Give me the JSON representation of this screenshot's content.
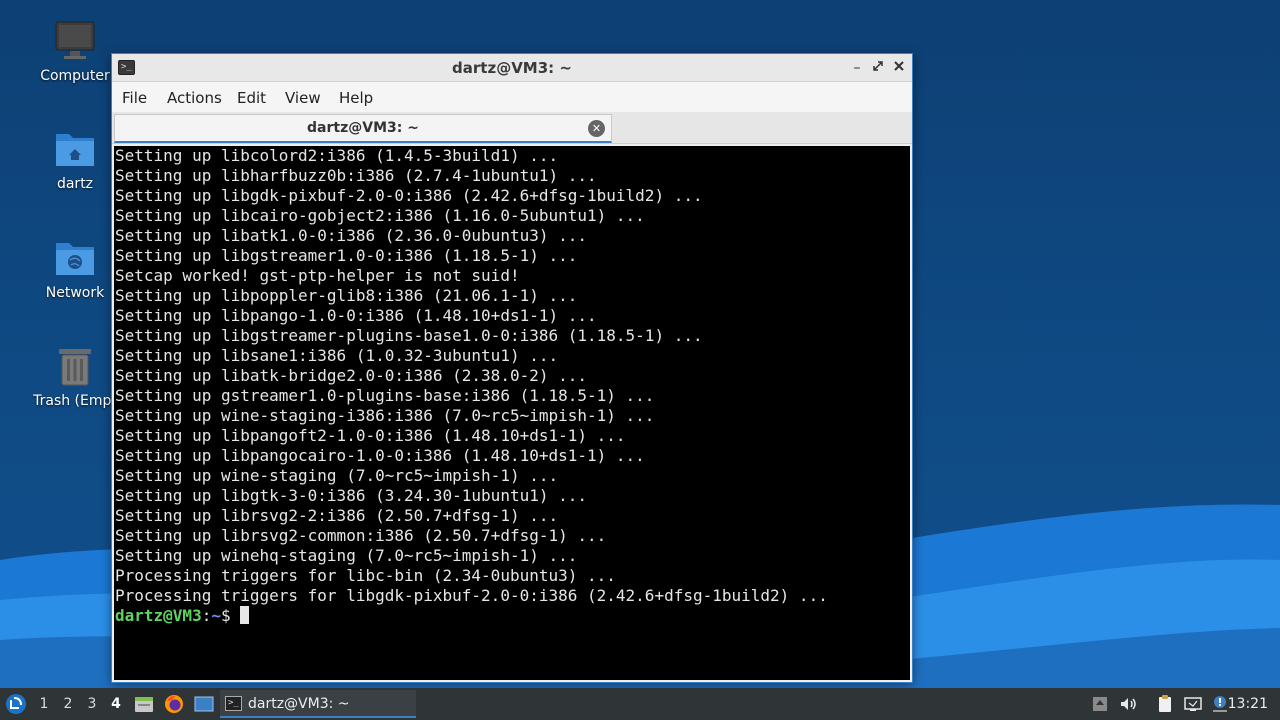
{
  "desktop": {
    "icons": [
      {
        "label": "Computer"
      },
      {
        "label": "dartz"
      },
      {
        "label": "Network"
      },
      {
        "label": "Trash (Empt"
      }
    ]
  },
  "window": {
    "title": "dartz@VM3: ~",
    "menu": [
      "File",
      "Actions",
      "Edit",
      "View",
      "Help"
    ],
    "tab_title": "dartz@VM3: ~",
    "terminal_lines": [
      "Setting up libcolord2:i386 (1.4.5-3build1) ...",
      "Setting up libharfbuzz0b:i386 (2.7.4-1ubuntu1) ...",
      "Setting up libgdk-pixbuf-2.0-0:i386 (2.42.6+dfsg-1build2) ...",
      "Setting up libcairo-gobject2:i386 (1.16.0-5ubuntu1) ...",
      "Setting up libatk1.0-0:i386 (2.36.0-0ubuntu3) ...",
      "Setting up libgstreamer1.0-0:i386 (1.18.5-1) ...",
      "Setcap worked! gst-ptp-helper is not suid!",
      "Setting up libpoppler-glib8:i386 (21.06.1-1) ...",
      "Setting up libpango-1.0-0:i386 (1.48.10+ds1-1) ...",
      "Setting up libgstreamer-plugins-base1.0-0:i386 (1.18.5-1) ...",
      "Setting up libsane1:i386 (1.0.32-3ubuntu1) ...",
      "Setting up libatk-bridge2.0-0:i386 (2.38.0-2) ...",
      "Setting up gstreamer1.0-plugins-base:i386 (1.18.5-1) ...",
      "Setting up wine-staging-i386:i386 (7.0~rc5~impish-1) ...",
      "Setting up libpangoft2-1.0-0:i386 (1.48.10+ds1-1) ...",
      "Setting up libpangocairo-1.0-0:i386 (1.48.10+ds1-1) ...",
      "Setting up wine-staging (7.0~rc5~impish-1) ...",
      "Setting up libgtk-3-0:i386 (3.24.30-1ubuntu1) ...",
      "Setting up librsvg2-2:i386 (2.50.7+dfsg-1) ...",
      "Setting up librsvg2-common:i386 (2.50.7+dfsg-1) ...",
      "Setting up winehq-staging (7.0~rc5~impish-1) ...",
      "Processing triggers for libc-bin (2.34-0ubuntu3) ...",
      "Processing triggers for libgdk-pixbuf-2.0-0:i386 (2.42.6+dfsg-1build2) ..."
    ],
    "prompt": {
      "user_host": "dartz@VM3",
      "sep": ":",
      "path": "~",
      "symbol": "$ "
    }
  },
  "taskbar": {
    "workspaces": [
      "1",
      "2",
      "3",
      "4"
    ],
    "active_workspace": "4",
    "task_label": "dartz@VM3: ~",
    "clock": "13:21"
  },
  "colors": {
    "accent": "#3b7fc4",
    "prompt_user": "#5ed35e",
    "prompt_path": "#6c8ff0",
    "terminal_bg": "#000000"
  }
}
